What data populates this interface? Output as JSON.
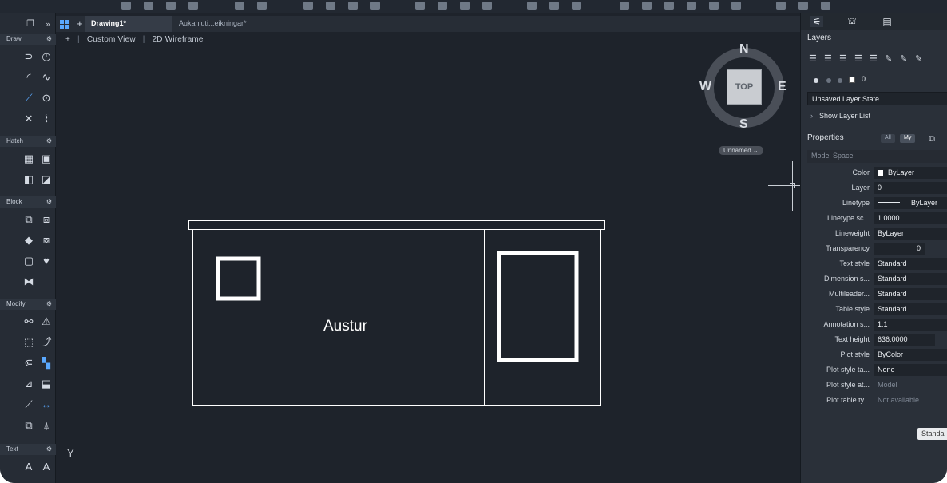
{
  "tabs": [
    {
      "label": "Drawing1*",
      "active": true
    },
    {
      "label": "Aukahluti...eikningar*",
      "active": false
    }
  ],
  "viewport": {
    "view_name": "Custom View",
    "visual_style": "2D Wireframe",
    "plus": "+",
    "drawing_text": "Austur",
    "ucs_axis": "Y"
  },
  "viewcube": {
    "face": "TOP",
    "north": "N",
    "south": "S",
    "east": "E",
    "west": "W",
    "ucs_menu": "Unnamed ⌄"
  },
  "left_palette": {
    "sections": [
      "Draw",
      "Hatch",
      "Block",
      "Modify",
      "Text"
    ],
    "gear": "⚙"
  },
  "right_panel": {
    "layers_title": "Layers",
    "current_layer": "0",
    "layer_state": "Unsaved Layer State",
    "show_layer_list": "Show Layer List",
    "show_layer_chevron": "›",
    "properties_title": "Properties",
    "filter_all": "All",
    "filter_my": "My",
    "context": "Model Space",
    "properties": [
      {
        "key": "Color",
        "value": "ByLayer"
      },
      {
        "key": "Layer",
        "value": "0"
      },
      {
        "key": "Linetype",
        "value": "ByLayer"
      },
      {
        "key": "Linetype sc...",
        "value": "1.0000"
      },
      {
        "key": "Lineweight",
        "value": "ByLayer"
      },
      {
        "key": "Transparency",
        "value": "0"
      },
      {
        "key": "Text style",
        "value": "Standard"
      },
      {
        "key": "Dimension s...",
        "value": "Standard"
      },
      {
        "key": "Multileader...",
        "value": "Standard"
      },
      {
        "key": "Table style",
        "value": "Standard"
      },
      {
        "key": "Annotation s...",
        "value": "1:1"
      },
      {
        "key": "Text height",
        "value": "636.0000"
      },
      {
        "key": "Plot style",
        "value": "ByColor"
      },
      {
        "key": "Plot style ta...",
        "value": "None"
      },
      {
        "key": "Plot style at...",
        "value": "Model"
      },
      {
        "key": "Plot table ty...",
        "value": "Not available"
      }
    ],
    "standard_button": "Standa"
  },
  "colors": {
    "canvas": "#1e232b",
    "accent": "#5aa9ff",
    "line": "#ffffff"
  }
}
